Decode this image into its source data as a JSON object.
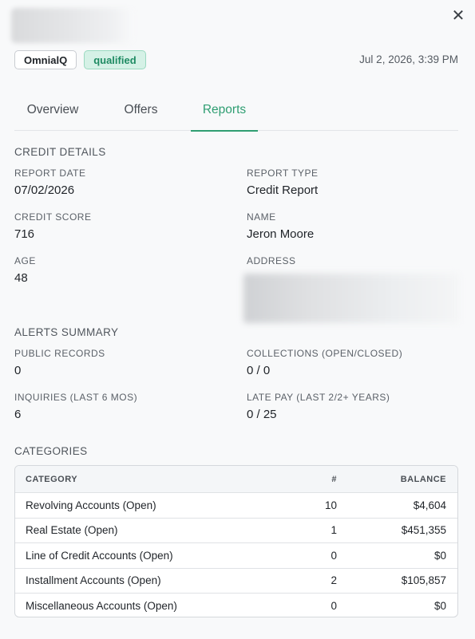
{
  "header": {
    "close_icon": "close-icon",
    "source_badge": "OmnialQ",
    "status_badge": "qualified",
    "timestamp": "Jul 2, 2026, 3:39 PM",
    "colors": {
      "accent": "#2f9e72",
      "status_bg": "#d5f1e6"
    }
  },
  "tabs": [
    {
      "label": "Overview"
    },
    {
      "label": "Offers"
    },
    {
      "label": "Reports",
      "active": true
    }
  ],
  "credit_details": {
    "title": "CREDIT DETAILS",
    "report_date": {
      "label": "REPORT DATE",
      "value": "07/02/2026"
    },
    "report_type": {
      "label": "REPORT TYPE",
      "value": "Credit Report"
    },
    "credit_score": {
      "label": "CREDIT SCORE",
      "value": "716"
    },
    "name": {
      "label": "NAME",
      "value": "Jeron Moore"
    },
    "age": {
      "label": "AGE",
      "value": "48"
    },
    "address": {
      "label": "ADDRESS"
    }
  },
  "alerts": {
    "title": "ALERTS SUMMARY",
    "public_records": {
      "label": "PUBLIC RECORDS",
      "value": "0"
    },
    "collections": {
      "label": "COLLECTIONS (OPEN/CLOSED)",
      "value": "0 / 0"
    },
    "inquiries": {
      "label": "INQUIRIES (LAST 6 MOS)",
      "value": "6"
    },
    "late_pay": {
      "label": "LATE PAY (LAST 2/2+ YEARS)",
      "value": "0 / 25"
    }
  },
  "categories": {
    "title": "CATEGORIES",
    "columns": [
      "CATEGORY",
      "#",
      "BALANCE"
    ],
    "rows": [
      {
        "category": "Revolving Accounts (Open)",
        "count": "10",
        "balance": "$4,604"
      },
      {
        "category": "Real Estate (Open)",
        "count": "1",
        "balance": "$451,355"
      },
      {
        "category": "Line of Credit Accounts (Open)",
        "count": "0",
        "balance": "$0"
      },
      {
        "category": "Installment Accounts (Open)",
        "count": "2",
        "balance": "$105,857"
      },
      {
        "category": "Miscellaneous Accounts (Open)",
        "count": "0",
        "balance": "$0"
      }
    ]
  }
}
